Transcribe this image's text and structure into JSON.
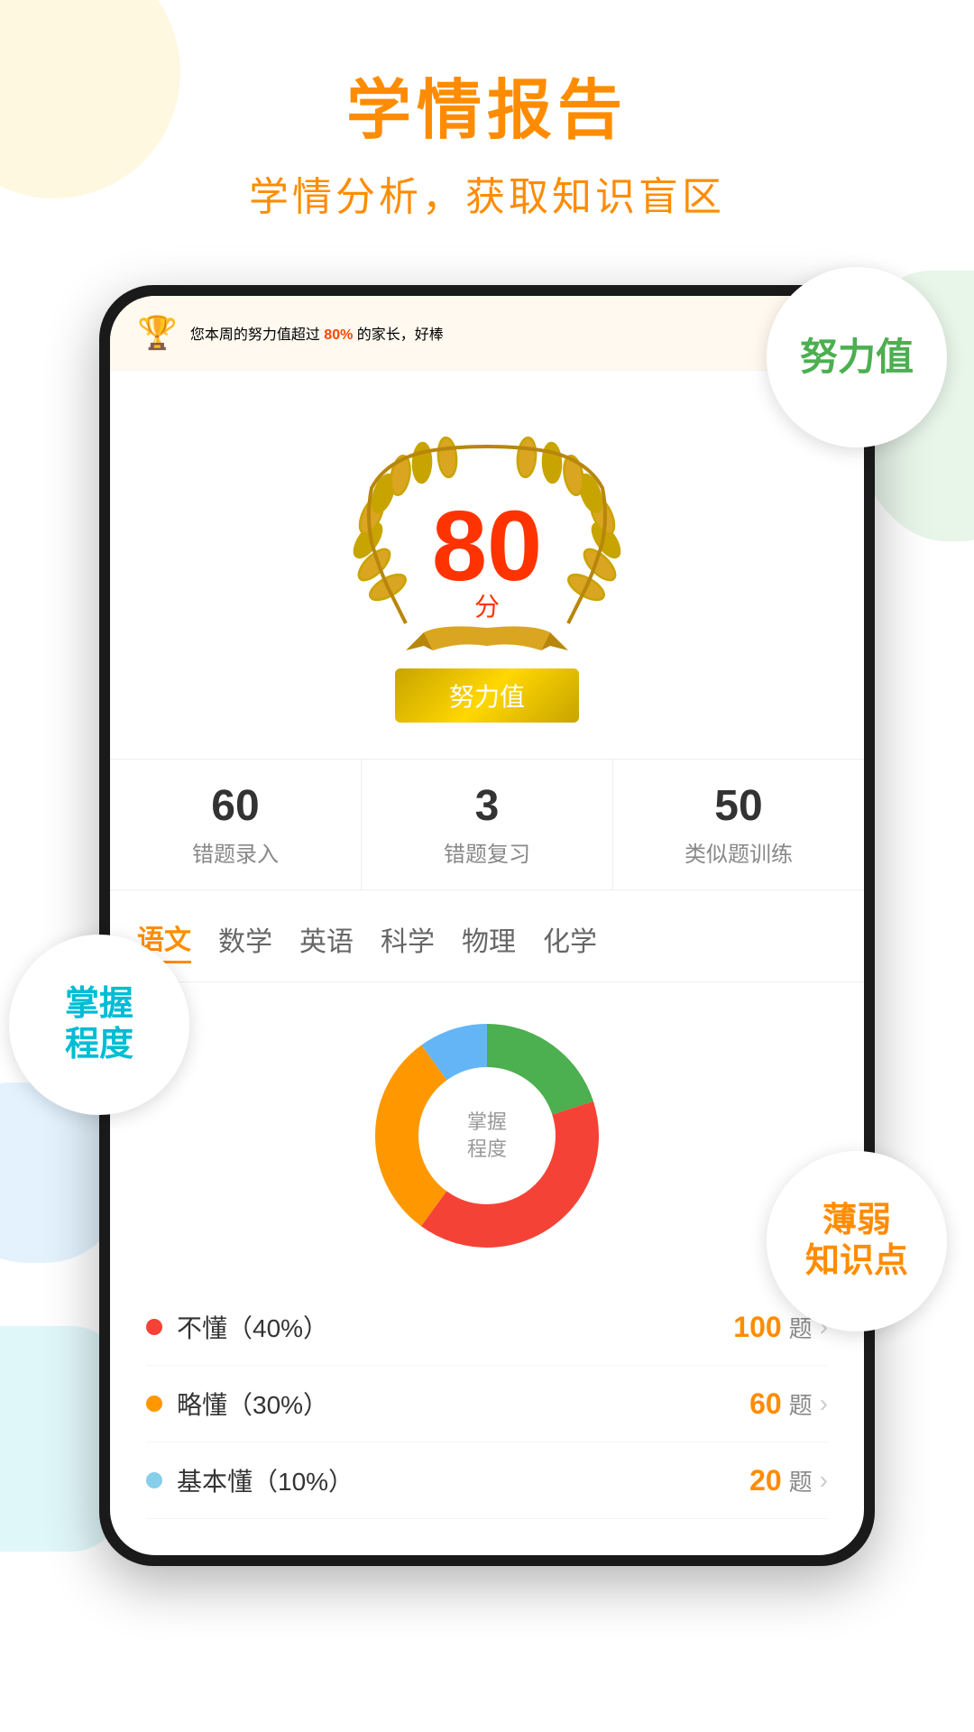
{
  "header": {
    "title": "学情报告",
    "subtitle": "学情分析，获取知识盲区"
  },
  "badges": {
    "effort": {
      "label1": "努力值",
      "label2": ""
    },
    "mastery": {
      "label1": "掌握",
      "label2": "程度"
    },
    "weak": {
      "label1": "薄弱",
      "label2": "知识点"
    }
  },
  "notification": {
    "text1": "您本周的努力值超过",
    "percent": "80%",
    "text2": "的家长，好棒"
  },
  "score": {
    "number": "80",
    "unit": "分",
    "label": "努力值"
  },
  "stats": [
    {
      "number": "60",
      "label": "错题录入"
    },
    {
      "number": "3",
      "label": "错题复习"
    },
    {
      "number": "50",
      "label": "类似题训练"
    }
  ],
  "subjects": [
    {
      "label": "语文",
      "active": true
    },
    {
      "label": "数学",
      "active": false
    },
    {
      "label": "英语",
      "active": false
    },
    {
      "label": "科学",
      "active": false
    },
    {
      "label": "物理",
      "active": false
    },
    {
      "label": "化学",
      "active": false
    }
  ],
  "chart": {
    "center_label1": "掌握",
    "center_label2": "程度",
    "segments": [
      {
        "label": "不懂（40%）",
        "color": "#F44336",
        "percent": 40,
        "count": "100",
        "dot_color": "#F44336"
      },
      {
        "label": "略懂（30%）",
        "color": "#FF9800",
        "percent": 30,
        "count": "60",
        "dot_color": "#FF9800"
      },
      {
        "label": "基本懂（10%）",
        "color": "#2196F3",
        "percent": 10,
        "count": "20",
        "dot_color": "#87CEEB"
      }
    ]
  },
  "colors": {
    "orange": "#FF8C00",
    "red": "#FF3300",
    "green": "#4CAF50",
    "teal": "#00BCD4",
    "gold": "#DAA520"
  }
}
